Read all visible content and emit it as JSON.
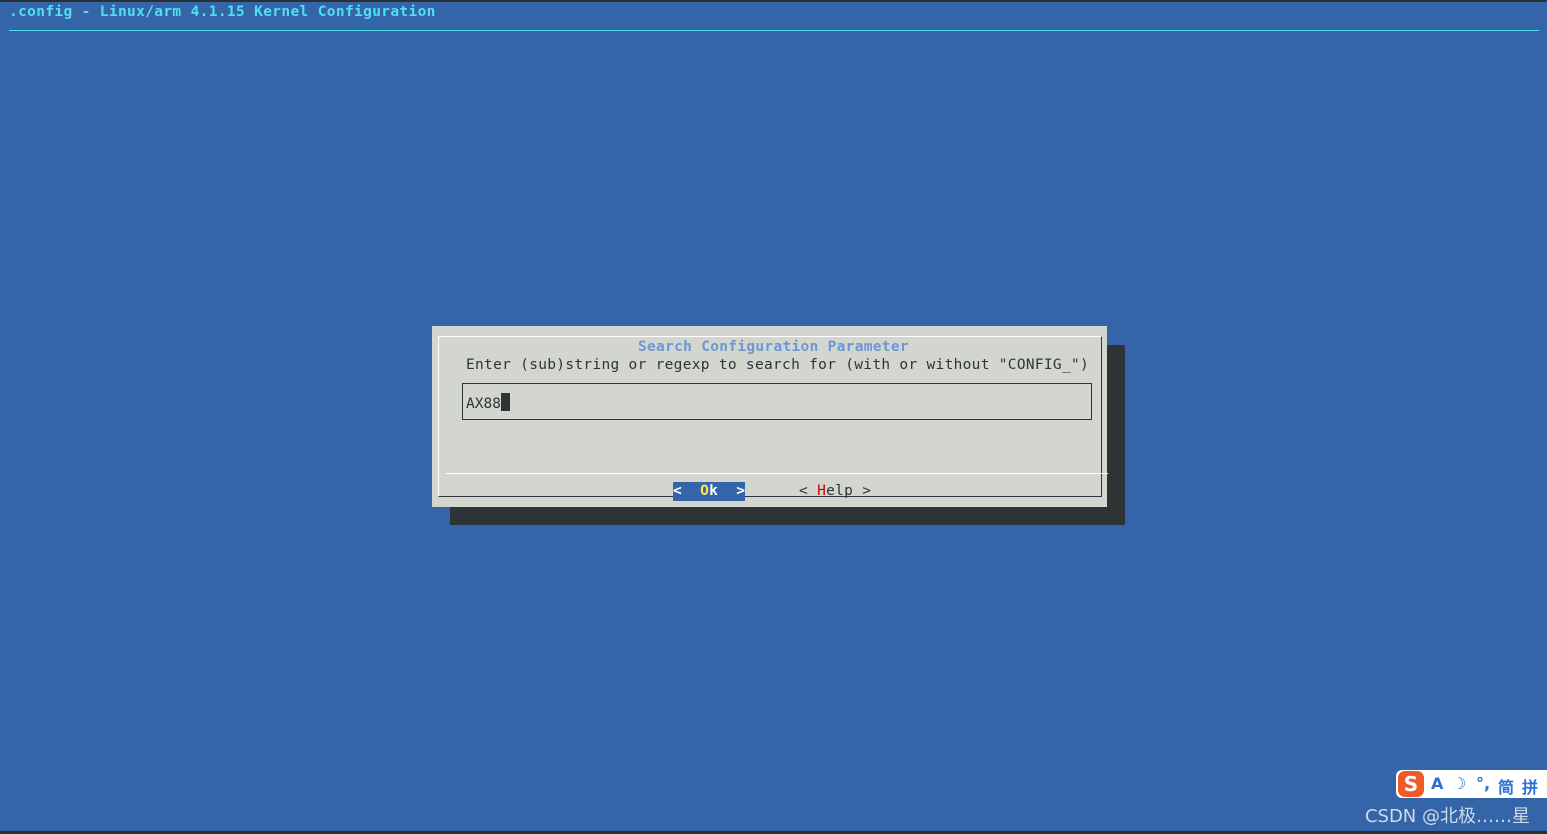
{
  "window": {
    "title": ".config - Linux/arm 4.1.15 Kernel Configuration"
  },
  "dialog": {
    "title": "Search Configuration Parameter",
    "prompt": "Enter (sub)string or regexp to search for (with or without \"CONFIG_\")",
    "input_value": "AX88",
    "buttons": {
      "ok": {
        "left": "<",
        "hotkey": "O",
        "rest": "k",
        "right": ">"
      },
      "help": {
        "left": "<",
        "hotkey": "H",
        "rest": "elp",
        "right": ">"
      }
    }
  },
  "ime_bar": {
    "logo": "S",
    "items": [
      "A",
      "☽",
      "°,",
      "简",
      "拼"
    ]
  },
  "watermark": "CSDN @北极……星",
  "colors": {
    "background": "#3465a8",
    "title": "#4fe0f0",
    "dialog": "#d3d6cf",
    "shadow": "#2e3436",
    "dialog_title": "#6d97d4",
    "selected_button": "#3465a8",
    "hotkey_selected": "#fce94f",
    "hotkey": "#cc0000"
  }
}
